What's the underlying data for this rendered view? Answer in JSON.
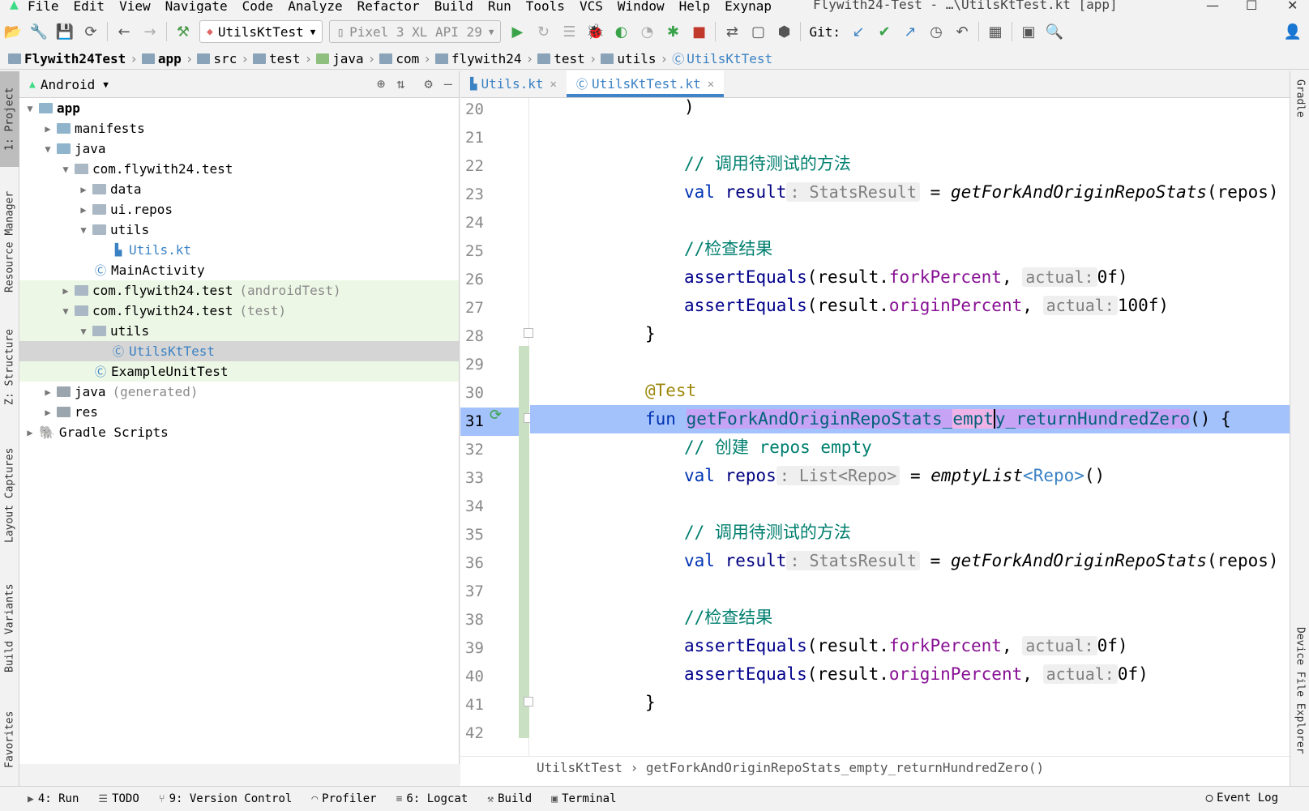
{
  "menubar": {
    "items": [
      "File",
      "Edit",
      "View",
      "Navigate",
      "Code",
      "Analyze",
      "Refactor",
      "Build",
      "Run",
      "Tools",
      "VCS",
      "Window",
      "Help",
      "Exynap"
    ],
    "window_title": "Flywith24-Test - …\\UtilsKtTest.kt [app]"
  },
  "toolbar": {
    "run_config": "UtilsKtTest",
    "device": "Pixel 3 XL API 29",
    "git_label": "Git:"
  },
  "breadcrumb": {
    "items": [
      "Flywith24Test",
      "app",
      "src",
      "test",
      "java",
      "com",
      "flywith24",
      "test",
      "utils",
      "UtilsKtTest"
    ]
  },
  "left_tabs": [
    "1: Project",
    "Resource Manager",
    "Z: Structure",
    "Layout Captures",
    "Build Variants",
    "Favorites"
  ],
  "right_tabs": [
    "Gradle",
    "Device File Explorer"
  ],
  "project": {
    "view": "Android",
    "tree": [
      {
        "label": "app",
        "bold": true
      },
      {
        "label": "manifests"
      },
      {
        "label": "java"
      },
      {
        "label": "com.flywith24.test"
      },
      {
        "label": "data"
      },
      {
        "label": "ui.repos"
      },
      {
        "label": "utils"
      },
      {
        "label": "Utils.kt"
      },
      {
        "label": "MainActivity"
      },
      {
        "label": "com.flywith24.test",
        "suffix": "(androidTest)"
      },
      {
        "label": "com.flywith24.test",
        "suffix": "(test)"
      },
      {
        "label": "utils"
      },
      {
        "label": "UtilsKtTest"
      },
      {
        "label": "ExampleUnitTest"
      },
      {
        "label": "java",
        "suffix": "(generated)"
      },
      {
        "label": "res"
      },
      {
        "label": "Gradle Scripts"
      }
    ]
  },
  "tabs": [
    {
      "label": "Utils.kt",
      "active": false
    },
    {
      "label": "UtilsKtTest.kt",
      "active": true
    }
  ],
  "editor": {
    "line_numbers": [
      "20",
      "21",
      "22",
      "23",
      "24",
      "25",
      "26",
      "27",
      "28",
      "29",
      "30",
      "31",
      "32",
      "33",
      "34",
      "35",
      "36",
      "37",
      "38",
      "39",
      "40",
      "41",
      "42"
    ],
    "code": {
      "l20": ")",
      "c22": "// 调用待测试的方法",
      "kw_val": "val",
      "result": "result",
      "hint_stats": ": StatsResult",
      "eq": " = ",
      "fn_get": "getForkAndOriginRepoStats",
      "repos_arg": "(repos)",
      "c25": "//检查结果",
      "assert": "assertEquals",
      "fork_arg": "(result.",
      "forkPercent": "forkPercent",
      "comma": ",",
      "hint_actual": "actual:",
      "zero_f": "0f)",
      "hundred_f": "100f)",
      "originPercent": "originPercent",
      "close_brace": "}",
      "annotation": "@Test",
      "kw_fun": "fun",
      "fn_name_a": "getForkAndOriginRepoStats_",
      "fn_name_b": "empt",
      "fn_name_c": "y_returnHundredZero",
      "fn_tail": "() {",
      "c32": "// 创建 repos empty",
      "repos": "repos",
      "hint_list": ": List<Repo>",
      "empty_list": "emptyList",
      "generic_repo": "<Repo>",
      "empty_parens": "()"
    },
    "status_path": "UtilsKtTest › getForkAndOriginRepoStats_empty_returnHundredZero()"
  },
  "bottom_bar": {
    "items": [
      "4: Run",
      "TODO",
      "9: Version Control",
      "Profiler",
      "6: Logcat",
      "Build",
      "Terminal"
    ],
    "event_log": "Event Log"
  }
}
